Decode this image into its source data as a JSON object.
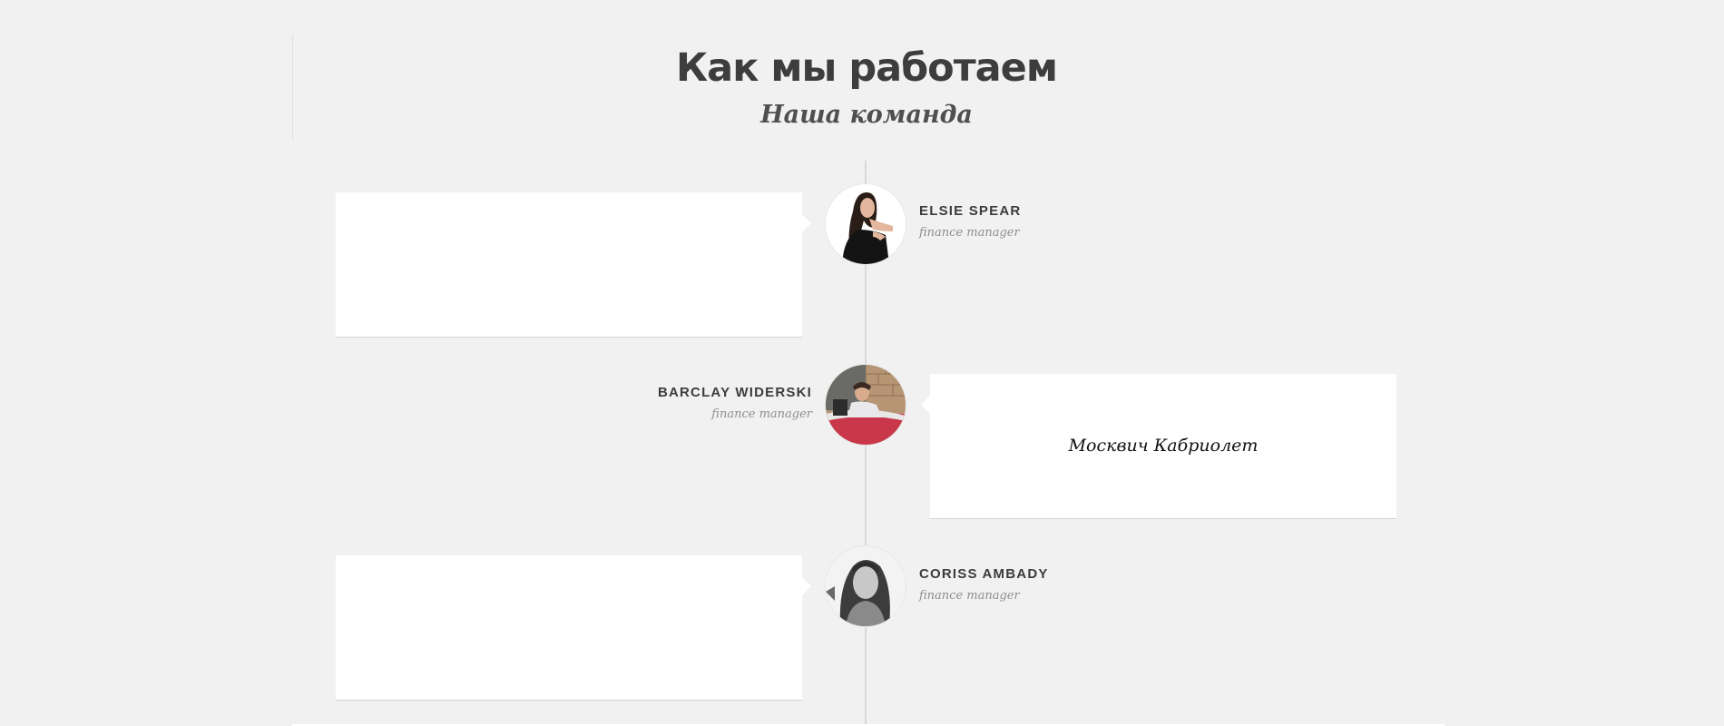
{
  "header": {
    "title": "Как мы работаем",
    "subtitle": "Наша команда"
  },
  "team": [
    {
      "name": "ELSIE SPEAR",
      "role": "finance manager",
      "card_text": "",
      "avatar": "portrait-woman-black-dress"
    },
    {
      "name": "BARCLAY WIDERSKI",
      "role": "finance manager",
      "card_text": "Москвич Кабриолет",
      "avatar": "portrait-man-in-red-convertible"
    },
    {
      "name": "CORISS AMBADY",
      "role": "finance manager",
      "card_text": "",
      "avatar": "portrait-woman-grayscale"
    }
  ],
  "colors": {
    "background": "#f1f1f1",
    "card": "#ffffff",
    "timeline": "#d9d9d9",
    "name_text": "#3c3c3c",
    "role_text": "#8e8e8e"
  }
}
